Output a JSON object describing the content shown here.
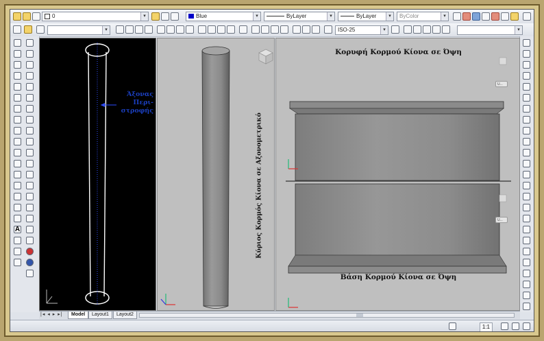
{
  "toolbar": {
    "layer_value": "0",
    "color_value": "Blue",
    "linetype_value": "ByLayer",
    "lineweight_value": "ByLayer",
    "plotstyle_value": "ByColor",
    "dimstyle_value": "ISO-25"
  },
  "icons": {
    "layer_icons": [
      "lightbulb-icon",
      "sun-icon",
      "lock-icon",
      "color-square-icon"
    ],
    "draw_tools": [
      "line-icon",
      "polyline-icon",
      "polygon-icon",
      "rectangle-icon",
      "arc-icon",
      "circle-icon",
      "revcloud-icon",
      "spline-icon",
      "ellipse-icon",
      "insert-block-icon",
      "make-block-icon",
      "point-icon",
      "hatch-icon",
      "gradient-icon",
      "region-icon",
      "table-icon",
      "multiline-text-icon"
    ],
    "modify_tools": [
      "erase-icon",
      "copy-icon",
      "mirror-icon",
      "offset-icon",
      "array-icon",
      "move-icon",
      "rotate-icon",
      "scale-icon",
      "stretch-icon",
      "trim-icon",
      "extend-icon",
      "break-icon",
      "join-icon",
      "chamfer-icon",
      "fillet-icon",
      "explode-icon"
    ],
    "view_tools": [
      "viewcube-icon",
      "ucs-icon"
    ]
  },
  "viewports": {
    "left": {
      "axis_label_lines": [
        "Άξονας",
        "Περι-",
        "στροφής"
      ]
    },
    "right": {
      "top_title": "Κορυφή Κορμού Κίονα σε Όψη",
      "bottom_title": "Βάση Κορμού Κίονα σε Όψη",
      "mini_label": "U..."
    },
    "middle": {
      "vertical_title": "Κύριος Κορμός Κίονα σε Αξονομετρικό"
    }
  },
  "layout_tabs": [
    "Model",
    "Layout1",
    "Layout2"
  ],
  "status": {
    "annotation_scale": "1:1"
  },
  "colors": {
    "viewport_black": "#000000",
    "viewport_gray": "#bfbfbf",
    "axis_label_blue": "#1b3fbf",
    "column_gray": "#8e8e8e",
    "frame_gold": "#d9c88e"
  }
}
